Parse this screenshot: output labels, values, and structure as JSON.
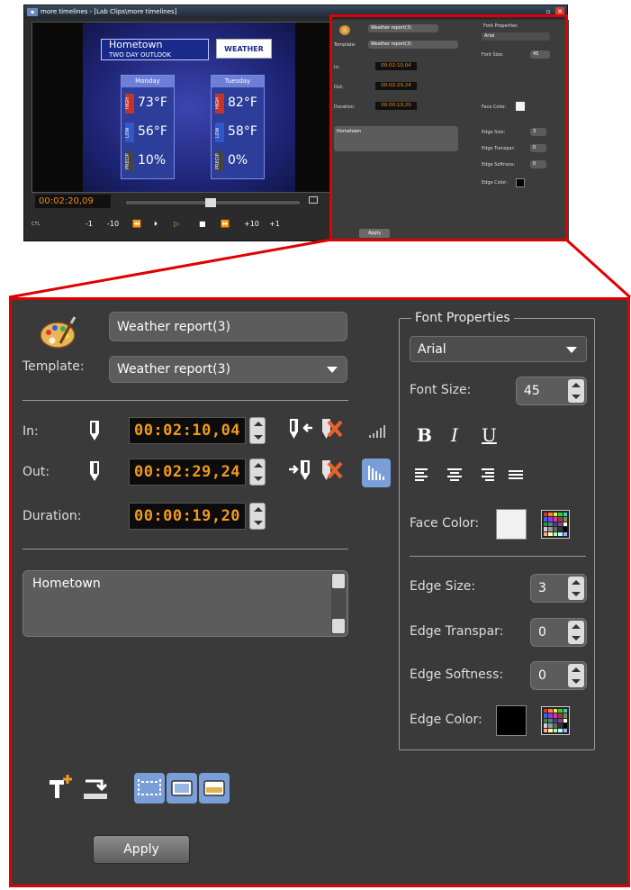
{
  "thumbnail": {
    "window_title": "more timelines - [Lab Clips\\more timelines]",
    "video": {
      "city": "Hometown",
      "outlook": "TWO DAY OUTLOOK",
      "logo": "WEATHER",
      "days": [
        {
          "day": "Monday",
          "high": "73°F",
          "low": "56°F",
          "precip": "10%"
        },
        {
          "day": "Tuesday",
          "high": "82°F",
          "low": "58°F",
          "precip": "0%"
        }
      ],
      "labels": {
        "high": "HIGH",
        "low": "LOW",
        "precip": "PRECIP"
      }
    },
    "timecode": "00:02:20,09",
    "ctl_label": "CTL",
    "transport": [
      "-1",
      "-10",
      "⏪",
      "⏵",
      "▷",
      "■",
      "⏩",
      "+10",
      "+1"
    ],
    "panel": {
      "template_label": "Template:",
      "template_value": "Weather report(3)",
      "name_value": "Weather report(3)",
      "in_label": "In:",
      "in_value": "00:02:10,04",
      "out_label": "Out:",
      "out_value": "00:02:29,24",
      "duration_label": "Duration:",
      "duration_value": "00:00:19,20",
      "text": "Hometown",
      "font_properties": "Font Properties",
      "font": "Arial",
      "font_size_label": "Font Size:",
      "font_size": "45",
      "face_color_label": "Face Color:",
      "edge_size_label": "Edge Size:",
      "edge_size": "3",
      "edge_transpar_label": "Edge Transpar:",
      "edge_transpar": "0",
      "edge_softness_label": "Edge Softness:",
      "edge_softness": "0",
      "edge_color_label": "Edge Color:",
      "apply": "Apply"
    }
  },
  "panel": {
    "name_value": "Weather report(3)",
    "template_label": "Template:",
    "template_value": "Weather report(3)",
    "in_label": "In:",
    "in_value": "00:02:10,04",
    "out_label": "Out:",
    "out_value": "00:02:29,24",
    "duration_label": "Duration:",
    "duration_value": "00:00:19,20",
    "text_content": "Hometown",
    "apply_label": "Apply"
  },
  "font_properties": {
    "title": "Font Properties",
    "font": "Arial",
    "font_size_label": "Font Size:",
    "font_size": "45",
    "bold": "B",
    "italic": "I",
    "underline": "U",
    "face_color_label": "Face Color:",
    "face_color": "#f2f2f2",
    "edge_size_label": "Edge Size:",
    "edge_size": "3",
    "edge_transpar_label": "Edge Transpar:",
    "edge_transpar": "0",
    "edge_softness_label": "Edge Softness:",
    "edge_softness": "0",
    "edge_color_label": "Edge Color:",
    "edge_color": "#000000"
  },
  "colors": {
    "highlight": "#e00000",
    "timecode": "#f39a1b",
    "panel_bg": "#3a3a3a",
    "toggle_active": "#7a9fd8"
  }
}
